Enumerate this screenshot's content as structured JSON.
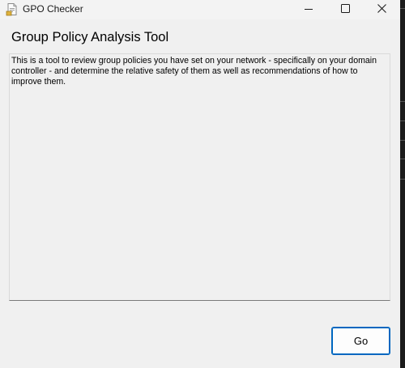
{
  "window": {
    "title": "GPO Checker",
    "accent_color": "#0067c0",
    "icons": {
      "app": "document-app-icon",
      "minimize": "minimize-icon",
      "maximize": "maximize-icon",
      "close": "close-icon"
    }
  },
  "main": {
    "heading": "Group Policy Analysis Tool",
    "description": "This is a tool to review group policies you have set on your network - specifically on your domain controller - and determine the relative safety of them as well as recommendations of how to improve them."
  },
  "actions": {
    "go_label": "Go"
  }
}
